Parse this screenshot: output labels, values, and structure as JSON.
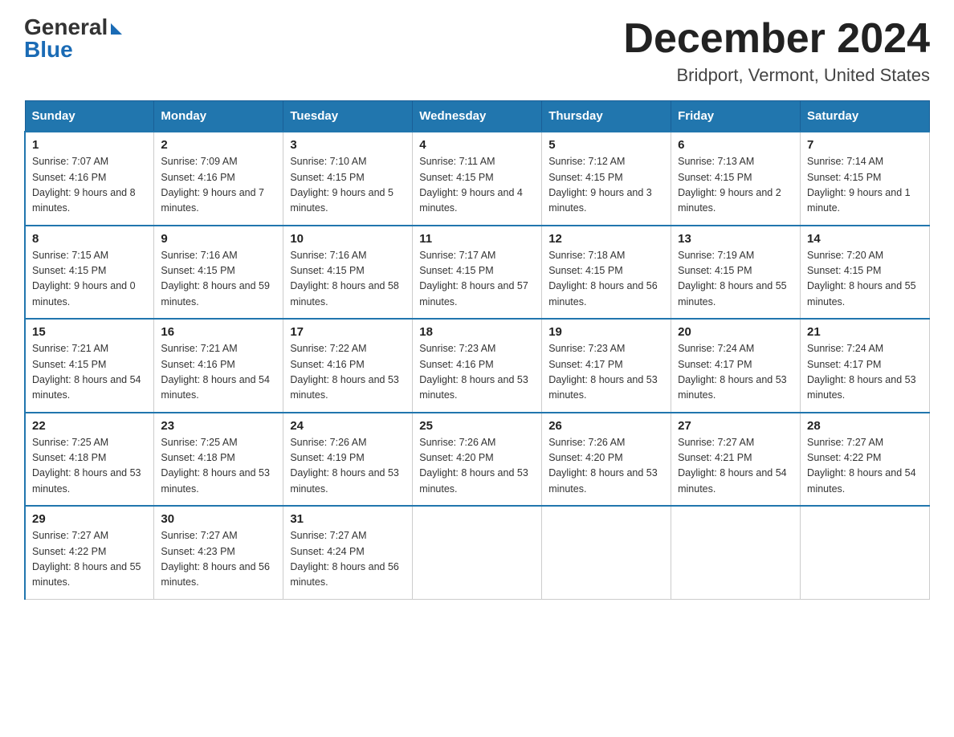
{
  "logo": {
    "general": "General",
    "blue": "Blue"
  },
  "title": {
    "month": "December 2024",
    "location": "Bridport, Vermont, United States"
  },
  "headers": [
    "Sunday",
    "Monday",
    "Tuesday",
    "Wednesday",
    "Thursday",
    "Friday",
    "Saturday"
  ],
  "weeks": [
    [
      {
        "day": "1",
        "sunrise": "7:07 AM",
        "sunset": "4:16 PM",
        "daylight": "9 hours and 8 minutes."
      },
      {
        "day": "2",
        "sunrise": "7:09 AM",
        "sunset": "4:16 PM",
        "daylight": "9 hours and 7 minutes."
      },
      {
        "day": "3",
        "sunrise": "7:10 AM",
        "sunset": "4:15 PM",
        "daylight": "9 hours and 5 minutes."
      },
      {
        "day": "4",
        "sunrise": "7:11 AM",
        "sunset": "4:15 PM",
        "daylight": "9 hours and 4 minutes."
      },
      {
        "day": "5",
        "sunrise": "7:12 AM",
        "sunset": "4:15 PM",
        "daylight": "9 hours and 3 minutes."
      },
      {
        "day": "6",
        "sunrise": "7:13 AM",
        "sunset": "4:15 PM",
        "daylight": "9 hours and 2 minutes."
      },
      {
        "day": "7",
        "sunrise": "7:14 AM",
        "sunset": "4:15 PM",
        "daylight": "9 hours and 1 minute."
      }
    ],
    [
      {
        "day": "8",
        "sunrise": "7:15 AM",
        "sunset": "4:15 PM",
        "daylight": "9 hours and 0 minutes."
      },
      {
        "day": "9",
        "sunrise": "7:16 AM",
        "sunset": "4:15 PM",
        "daylight": "8 hours and 59 minutes."
      },
      {
        "day": "10",
        "sunrise": "7:16 AM",
        "sunset": "4:15 PM",
        "daylight": "8 hours and 58 minutes."
      },
      {
        "day": "11",
        "sunrise": "7:17 AM",
        "sunset": "4:15 PM",
        "daylight": "8 hours and 57 minutes."
      },
      {
        "day": "12",
        "sunrise": "7:18 AM",
        "sunset": "4:15 PM",
        "daylight": "8 hours and 56 minutes."
      },
      {
        "day": "13",
        "sunrise": "7:19 AM",
        "sunset": "4:15 PM",
        "daylight": "8 hours and 55 minutes."
      },
      {
        "day": "14",
        "sunrise": "7:20 AM",
        "sunset": "4:15 PM",
        "daylight": "8 hours and 55 minutes."
      }
    ],
    [
      {
        "day": "15",
        "sunrise": "7:21 AM",
        "sunset": "4:15 PM",
        "daylight": "8 hours and 54 minutes."
      },
      {
        "day": "16",
        "sunrise": "7:21 AM",
        "sunset": "4:16 PM",
        "daylight": "8 hours and 54 minutes."
      },
      {
        "day": "17",
        "sunrise": "7:22 AM",
        "sunset": "4:16 PM",
        "daylight": "8 hours and 53 minutes."
      },
      {
        "day": "18",
        "sunrise": "7:23 AM",
        "sunset": "4:16 PM",
        "daylight": "8 hours and 53 minutes."
      },
      {
        "day": "19",
        "sunrise": "7:23 AM",
        "sunset": "4:17 PM",
        "daylight": "8 hours and 53 minutes."
      },
      {
        "day": "20",
        "sunrise": "7:24 AM",
        "sunset": "4:17 PM",
        "daylight": "8 hours and 53 minutes."
      },
      {
        "day": "21",
        "sunrise": "7:24 AM",
        "sunset": "4:17 PM",
        "daylight": "8 hours and 53 minutes."
      }
    ],
    [
      {
        "day": "22",
        "sunrise": "7:25 AM",
        "sunset": "4:18 PM",
        "daylight": "8 hours and 53 minutes."
      },
      {
        "day": "23",
        "sunrise": "7:25 AM",
        "sunset": "4:18 PM",
        "daylight": "8 hours and 53 minutes."
      },
      {
        "day": "24",
        "sunrise": "7:26 AM",
        "sunset": "4:19 PM",
        "daylight": "8 hours and 53 minutes."
      },
      {
        "day": "25",
        "sunrise": "7:26 AM",
        "sunset": "4:20 PM",
        "daylight": "8 hours and 53 minutes."
      },
      {
        "day": "26",
        "sunrise": "7:26 AM",
        "sunset": "4:20 PM",
        "daylight": "8 hours and 53 minutes."
      },
      {
        "day": "27",
        "sunrise": "7:27 AM",
        "sunset": "4:21 PM",
        "daylight": "8 hours and 54 minutes."
      },
      {
        "day": "28",
        "sunrise": "7:27 AM",
        "sunset": "4:22 PM",
        "daylight": "8 hours and 54 minutes."
      }
    ],
    [
      {
        "day": "29",
        "sunrise": "7:27 AM",
        "sunset": "4:22 PM",
        "daylight": "8 hours and 55 minutes."
      },
      {
        "day": "30",
        "sunrise": "7:27 AM",
        "sunset": "4:23 PM",
        "daylight": "8 hours and 56 minutes."
      },
      {
        "day": "31",
        "sunrise": "7:27 AM",
        "sunset": "4:24 PM",
        "daylight": "8 hours and 56 minutes."
      },
      null,
      null,
      null,
      null
    ]
  ]
}
